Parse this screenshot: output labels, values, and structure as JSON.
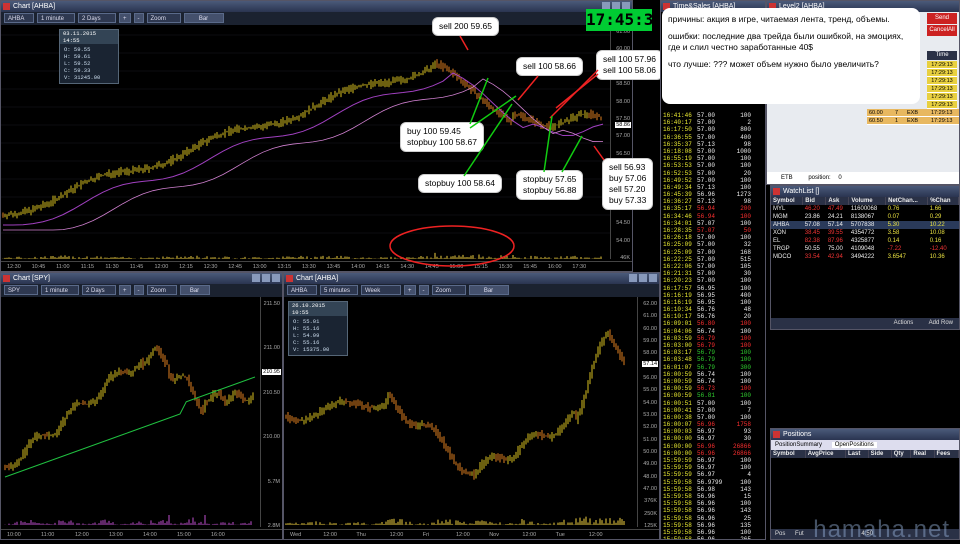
{
  "main_chart": {
    "title": "Chart [AHBA]",
    "toolbar": [
      "AHBA",
      "1 minute",
      "2 Days",
      "+",
      "-",
      "Zoom",
      "Bar"
    ],
    "ohlc": {
      "date": "03.11.2015 14:55",
      "o": "O: 59.55",
      "h": "H: 59.61",
      "l": "L: 59.52",
      "c": "C: 59.33",
      "v": "V: 31245.00"
    },
    "y_ticks": [
      "61.00",
      "60.00",
      "59.00",
      "58.50",
      "58.00",
      "57.50",
      "57.00",
      "56.50",
      "56.00",
      "55.50",
      "55.00",
      "54.50",
      "54.00",
      "46K"
    ],
    "x_ticks": [
      "12:30",
      "10:45",
      "11:00",
      "11:15",
      "11:30",
      "11:45",
      "12:00",
      "12:15",
      "12:30",
      "12:45",
      "13:00",
      "13:15",
      "13:30",
      "13:45",
      "14:00",
      "14:15",
      "14:30",
      "14:45",
      "15:00",
      "15:15",
      "15:30",
      "15:45",
      "16:00",
      "17:30"
    ],
    "price_tag": "58.86"
  },
  "callouts": {
    "sell1": "sell 200 59.65",
    "sell2": "sell 100 58.66",
    "sell3": "sell 100 57.96\nsell 100 58.06",
    "buy1": "buy 100 59.45\nstopbuy 100 58.67",
    "stopbuy1": "stopbuy 100 58.64",
    "stopbuy2": "stopbuy 57.65\nstopbuy 56.88",
    "last": "sell 56.93\nbuy 57.06\nsell 57.20\nbuy 57.33"
  },
  "note": {
    "line1": "причины:   акция в игре, читаемая лента, тренд, объемы.",
    "line2": "ошибки:  последние два трейда были ошибкой, на эмоциях, где и слил честно заработанные 40$",
    "line3": "что лучше: ??? может объем нужно было увеличить?"
  },
  "clock": "17:45:33",
  "time_sales": {
    "title": "Time&Sales [AHBA]",
    "rows": [
      [
        "16:41:46",
        "57.00",
        "100",
        "w"
      ],
      [
        "16:40:17",
        "57.00",
        "2",
        "w"
      ],
      [
        "16:17:50",
        "57.00",
        "800",
        "w"
      ],
      [
        "16:36:55",
        "57.00",
        "400",
        "w"
      ],
      [
        "16:35:37",
        "57.13",
        "98",
        "w"
      ],
      [
        "16:18:08",
        "57.00",
        "1000",
        "w"
      ],
      [
        "16:55:19",
        "57.00",
        "100",
        "w"
      ],
      [
        "16:53:53",
        "57.00",
        "100",
        "w"
      ],
      [
        "16:52:53",
        "57.00",
        "20",
        "w"
      ],
      [
        "16:49:52",
        "57.00",
        "100",
        "w"
      ],
      [
        "16:49:34",
        "57.13",
        "100",
        "w"
      ],
      [
        "16:45:39",
        "56.96",
        "1273",
        "w"
      ],
      [
        "16:36:27",
        "57.13",
        "98",
        "w"
      ],
      [
        "16:35:17",
        "56.94",
        "200",
        "r"
      ],
      [
        "16:34:46",
        "56.94",
        "100",
        "r"
      ],
      [
        "16:34:01",
        "57.07",
        "100",
        "w"
      ],
      [
        "16:28:35",
        "57.07",
        "50",
        "r"
      ],
      [
        "16:26:18",
        "57.00",
        "100",
        "w"
      ],
      [
        "16:25:09",
        "57.00",
        "32",
        "w"
      ],
      [
        "16:25:09",
        "57.00",
        "168",
        "w"
      ],
      [
        "16:22:25",
        "57.00",
        "515",
        "w"
      ],
      [
        "16:22:06",
        "57.00",
        "105",
        "w"
      ],
      [
        "16:21:31",
        "57.00",
        "30",
        "w"
      ],
      [
        "16:20:23",
        "57.00",
        "100",
        "w"
      ],
      [
        "16:17:57",
        "56.95",
        "100",
        "w"
      ],
      [
        "16:16:19",
        "56.95",
        "400",
        "w"
      ],
      [
        "16:16:19",
        "56.95",
        "100",
        "w"
      ],
      [
        "16:10:34",
        "56.76",
        "48",
        "w"
      ],
      [
        "16:10:17",
        "56.76",
        "20",
        "w"
      ],
      [
        "16:09:01",
        "56.80",
        "100",
        "r"
      ],
      [
        "16:04:06",
        "56.74",
        "100",
        "w"
      ],
      [
        "16:03:59",
        "56.79",
        "100",
        "r"
      ],
      [
        "16:03:00",
        "56.79",
        "100",
        "r"
      ],
      [
        "16:03:17",
        "56.79",
        "100",
        "g"
      ],
      [
        "16:03:48",
        "56.79",
        "100",
        "g"
      ],
      [
        "16:01:07",
        "56.79",
        "300",
        "g"
      ],
      [
        "16:00:59",
        "56.74",
        "100",
        "w"
      ],
      [
        "16:00:59",
        "56.74",
        "100",
        "w"
      ],
      [
        "16:00:59",
        "56.73",
        "100",
        "r"
      ],
      [
        "16:00:59",
        "56.81",
        "100",
        "g"
      ],
      [
        "16:00:51",
        "57.00",
        "100",
        "w"
      ],
      [
        "16:00:41",
        "57.00",
        "7",
        "w"
      ],
      [
        "16:00:38",
        "57.00",
        "100",
        "w"
      ],
      [
        "16:00:07",
        "56.96",
        "1758",
        "r"
      ],
      [
        "16:00:03",
        "56.97",
        "93",
        "w"
      ],
      [
        "16:00:00",
        "56.97",
        "30",
        "w"
      ],
      [
        "16:00:00",
        "56.96",
        "26866",
        "r"
      ],
      [
        "16:00:00",
        "56.96",
        "26866",
        "r"
      ],
      [
        "15:59:59",
        "56.97",
        "100",
        "w"
      ],
      [
        "15:59:59",
        "56.97",
        "100",
        "w"
      ],
      [
        "15:59:59",
        "56.97",
        "4",
        "w"
      ],
      [
        "15:59:58",
        "56.9799",
        "100",
        "w"
      ],
      [
        "15:59:58",
        "56.98",
        "143",
        "w"
      ],
      [
        "15:59:58",
        "56.96",
        "15",
        "w"
      ],
      [
        "15:59:58",
        "56.96",
        "100",
        "w"
      ],
      [
        "15:59:58",
        "56.96",
        "143",
        "w"
      ],
      [
        "15:59:58",
        "56.96",
        "25",
        "w"
      ],
      [
        "15:59:58",
        "56.96",
        "135",
        "w"
      ],
      [
        "15:59:58",
        "56.96",
        "100",
        "w"
      ],
      [
        "15:59:58",
        "56.96",
        "265",
        "w"
      ]
    ]
  },
  "level2": {
    "title": "Level2 [AHBA]",
    "buttons": [
      "Send",
      "CancelAll"
    ],
    "header": "Time",
    "times": [
      "17:29:13",
      "17:29:13",
      "17:29:13",
      "17:29:13",
      "17:29:13",
      "17:29:13",
      "17:29:13",
      "17:29:13"
    ],
    "rows": [
      [
        "60.00",
        "7",
        "EXB",
        "17:29:13"
      ],
      [
        "60.50",
        "1",
        "EXB",
        "17:29:13"
      ]
    ],
    "etb": "ETB",
    "position_label": "position:",
    "position_value": "0"
  },
  "watchlist": {
    "title": "WatchList []",
    "headers": [
      "Symbol",
      "Bid",
      "Ask",
      "Volume",
      "NetChan...",
      "%Chan"
    ],
    "rows": [
      {
        "sym": "MYL",
        "bid": "46.20",
        "ask": "47.49",
        "vol": "11600068",
        "net": "0.76",
        "pct": "1.66",
        "color": "#e33"
      },
      {
        "sym": "MGM",
        "bid": "23.86",
        "ask": "24.21",
        "vol": "8138067",
        "net": "0.07",
        "pct": "0.29",
        "color": "#eee"
      },
      {
        "sym": "AHBA",
        "bid": "57.08",
        "ask": "57.14",
        "vol": "5707838",
        "net": "5.30",
        "pct": "10.22",
        "color": "#eee"
      },
      {
        "sym": "XON",
        "bid": "38.45",
        "ask": "39.55",
        "vol": "4354772",
        "net": "3.58",
        "pct": "10.08",
        "color": "#e33"
      },
      {
        "sym": "EL",
        "bid": "82.38",
        "ask": "87.96",
        "vol": "4325877",
        "net": "0.14",
        "pct": "0.16",
        "color": "#e33"
      },
      {
        "sym": "TRGP",
        "bid": "50.55",
        "ask": "75.00",
        "vol": "4109048",
        "net": "-7.22",
        "pct": "-12.40",
        "color": "#eee"
      },
      {
        "sym": "MDCO",
        "bid": "33.54",
        "ask": "42.94",
        "vol": "3494222",
        "net": "3.6547",
        "pct": "10.36",
        "color": "#e33"
      }
    ],
    "actions": "Actions",
    "add_row": "Add Row"
  },
  "positions": {
    "title": "Positions",
    "tabs": [
      "PositionSummary",
      "OpenPositions"
    ],
    "headers": [
      "Symbol",
      "AvgPrice",
      "Last",
      "Side",
      "Qty",
      "Real",
      "Fees"
    ]
  },
  "spy_chart": {
    "title": "Chart [SPY]",
    "toolbar": [
      "SPY",
      "1 minute",
      "2 Days",
      "+",
      "-",
      "Zoom",
      "Bar"
    ],
    "y_ticks": [
      "211.50",
      "211.00",
      "210.50",
      "210.00",
      "5.7M",
      "2.8M"
    ],
    "x_ticks": [
      "10:00",
      "11:00",
      "12:00",
      "13:00",
      "14:00",
      "15:00",
      "16:00"
    ],
    "price_tag": "210.95"
  },
  "week_chart": {
    "title": "Chart [AHBA]",
    "toolbar": [
      "AHBA",
      "5 minutes",
      "Week",
      "+",
      "-",
      "Zoom",
      "Bar"
    ],
    "ohlc": {
      "date": "26.10.2015 10:55",
      "o": "O: 55.01",
      "h": "H: 55.16",
      "l": "L: 54.99",
      "c": "C: 55.16",
      "v": "V: 15375.00"
    },
    "y_ticks": [
      "62.00",
      "61.00",
      "60.00",
      "59.00",
      "58.00",
      "57.00",
      "56.00",
      "55.00",
      "54.00",
      "53.00",
      "52.00",
      "51.00",
      "50.00",
      "49.00",
      "48.00",
      "47.00",
      "376K",
      "250K",
      "125K"
    ],
    "x_ticks": [
      "Wed",
      "12:00",
      "Thu",
      "12:00",
      "Fri",
      "12:00",
      "Nov",
      "12:00",
      "Tue",
      "12:00"
    ],
    "price_tag": "57.14"
  },
  "bottom_bar": {
    "pos": "Pos",
    "fut": "Fut",
    "time": "4:50"
  },
  "watermark": "hamaha.net"
}
